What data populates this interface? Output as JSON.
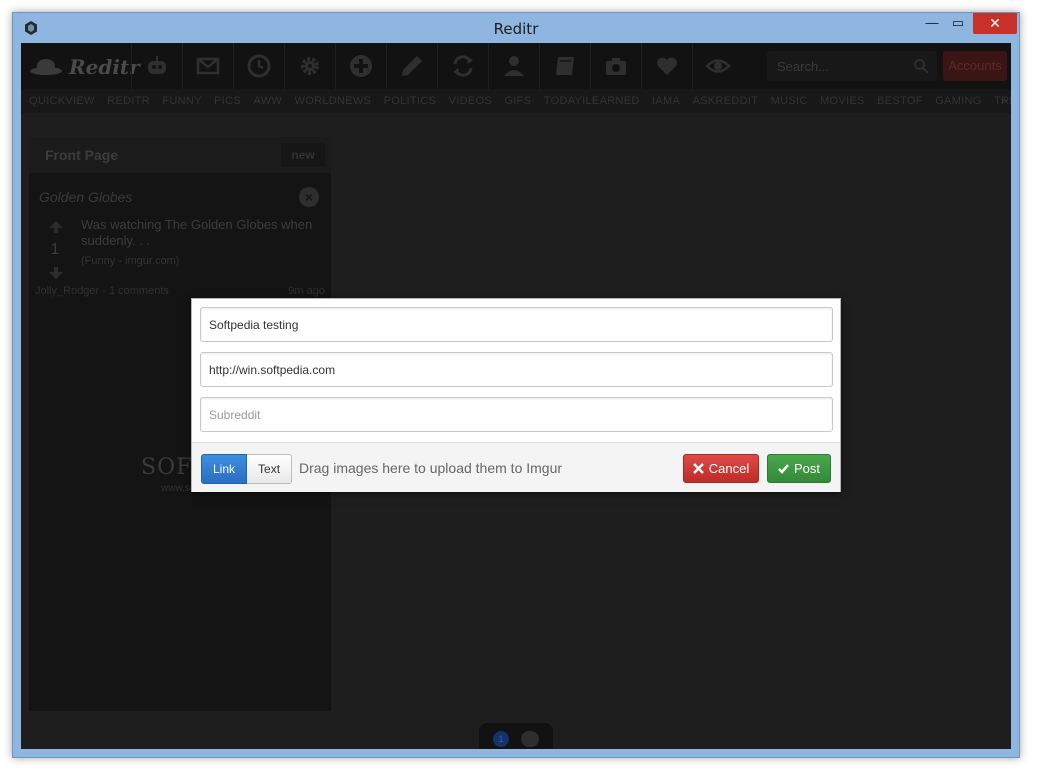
{
  "window": {
    "title": "Reditr",
    "min_glyph": "—",
    "max_glyph": "▭",
    "close_glyph": "✕"
  },
  "toolbar": {
    "logo_text": "Reditr",
    "icons": [
      "bot-icon",
      "mail-icon",
      "clock-icon",
      "gear-icon",
      "plus-icon",
      "pencil-icon",
      "refresh-icon",
      "user-icon",
      "book-icon",
      "camera-icon",
      "heart-icon",
      "eye-icon"
    ],
    "search_placeholder": "Search...",
    "accounts_label": "Accounts"
  },
  "subnav": {
    "items": [
      "QUICKVIEW",
      "REDITR",
      "FUNNY",
      "PICS",
      "AWW",
      "WORLDNEWS",
      "POLITICS",
      "VIDEOS",
      "GIFS",
      "TODAYILEARNED",
      "IAMA",
      "ASKREDDIT",
      "MUSIC",
      "MOVIES",
      "BESTOF",
      "GAMING",
      "TREES"
    ],
    "more_glyph": "»"
  },
  "panel": {
    "title": "Front Page",
    "new_label": "new",
    "story": {
      "group": "Golden Globes",
      "close_glyph": "×",
      "votes": "1",
      "title": "Was watching The Golden Globes when suddenly. . .",
      "source": "(Funny - imgur.com)",
      "meta": "Jolly_Rodger - 1 comments",
      "age": "9m ago"
    }
  },
  "watermark": {
    "text": "SOFTPEDIA",
    "sub": "www.softpedia.com"
  },
  "dock": {
    "badge": "1"
  },
  "modal": {
    "title_value": "Softpedia testing",
    "url_value": "http://win.softpedia.com",
    "subreddit_placeholder": "Subreddit",
    "link_label": "Link",
    "text_label": "Text",
    "drop_hint": "Drag images here to upload them to Imgur",
    "cancel_label": "Cancel",
    "post_label": "Post"
  },
  "colors": {
    "accent_blue": "#2a6fc2",
    "cancel_red": "#c9302c",
    "post_green": "#3c923f",
    "close_red": "#c7312a"
  }
}
